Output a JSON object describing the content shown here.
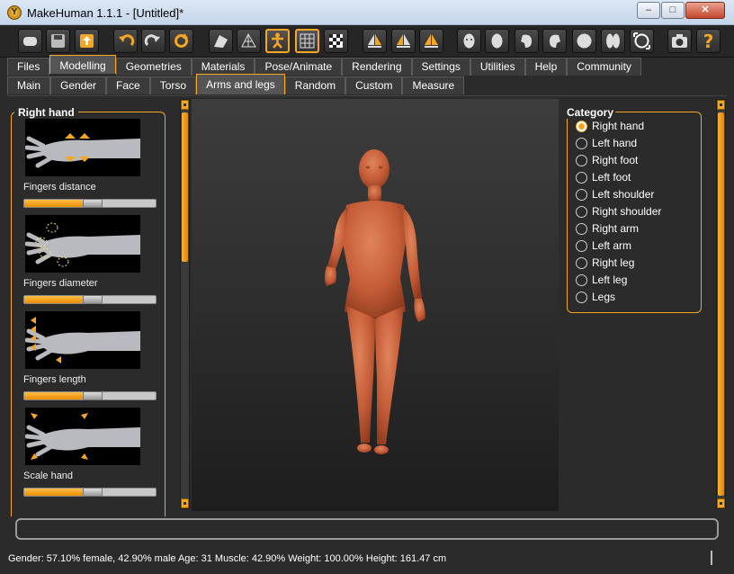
{
  "window": {
    "title": "MakeHuman 1.1.1 - [Untitled]*",
    "minimize": "–",
    "maximize": "□",
    "close": "✕",
    "app_icon_letter": "Y"
  },
  "toolbar": {
    "buttons": [
      {
        "name": "new-model-icon"
      },
      {
        "name": "save-icon"
      },
      {
        "name": "export-icon"
      },
      {
        "name": "undo-icon"
      },
      {
        "name": "redo-icon"
      },
      {
        "name": "reset-icon"
      },
      {
        "name": "smooth-icon"
      },
      {
        "name": "wireframe-icon"
      },
      {
        "name": "pose-icon"
      },
      {
        "name": "grid-icon"
      },
      {
        "name": "background-icon"
      },
      {
        "name": "symmetry-right-icon"
      },
      {
        "name": "symmetry-left-icon"
      },
      {
        "name": "symmetry-icon"
      },
      {
        "name": "front-view-icon"
      },
      {
        "name": "back-view-icon"
      },
      {
        "name": "left-view-icon"
      },
      {
        "name": "right-view-icon"
      },
      {
        "name": "top-view-icon"
      },
      {
        "name": "bottom-view-icon"
      },
      {
        "name": "reset-camera-icon"
      },
      {
        "name": "screenshot-icon"
      },
      {
        "name": "help-icon"
      }
    ],
    "help_glyph": "?"
  },
  "main_tabs": [
    "Files",
    "Modelling",
    "Geometries",
    "Materials",
    "Pose/Animate",
    "Rendering",
    "Settings",
    "Utilities",
    "Help",
    "Community"
  ],
  "main_tab_active": "Modelling",
  "sub_tabs": [
    "Main",
    "Gender",
    "Face",
    "Torso",
    "Arms and legs",
    "Random",
    "Custom",
    "Measure"
  ],
  "sub_tab_active": "Arms and legs",
  "left_panel": {
    "title": "Right hand",
    "sliders": [
      {
        "label": "Fingers distance",
        "value": 0.5
      },
      {
        "label": "Fingers diameter",
        "value": 0.5
      },
      {
        "label": "Fingers length",
        "value": 0.5
      },
      {
        "label": "Scale hand",
        "value": 0.5
      }
    ]
  },
  "right_panel": {
    "title": "Category",
    "options": [
      "Right hand",
      "Left hand",
      "Right foot",
      "Left foot",
      "Left shoulder",
      "Right shoulder",
      "Right arm",
      "Left arm",
      "Right leg",
      "Left leg",
      "Legs"
    ],
    "selected": "Right hand"
  },
  "status": "Gender: 57.10% female, 42.90% male Age: 31 Muscle: 42.90% Weight: 100.00% Height: 161.47 cm",
  "colors": {
    "accent": "#f5a623",
    "skin": "#c8603c",
    "background": "#2b2b2b"
  }
}
